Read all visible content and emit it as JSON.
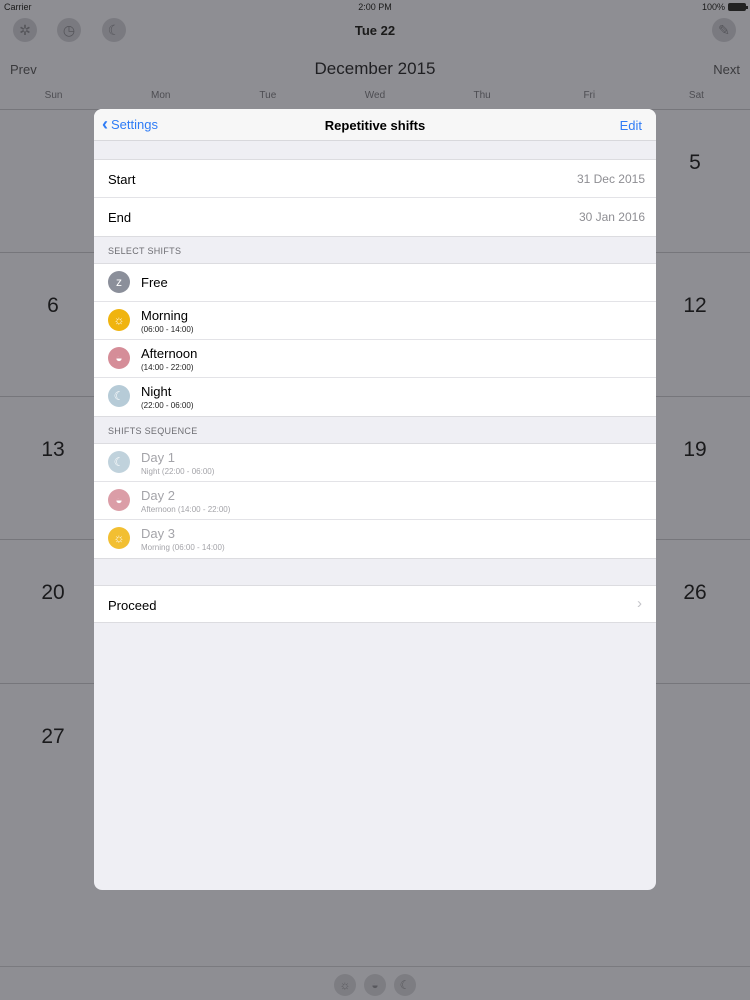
{
  "status_bar": {
    "carrier": "Carrier",
    "time": "2:00 PM",
    "battery": "100%"
  },
  "toolbar": {
    "date": "Tue 22",
    "icons": [
      "gear-icon",
      "clock-icon",
      "moon-icon",
      "brush-icon"
    ]
  },
  "calendar": {
    "prev": "Prev",
    "next": "Next",
    "month": "December 2015",
    "weekdays": [
      "Sun",
      "Mon",
      "Tue",
      "Wed",
      "Thu",
      "Fri",
      "Sat"
    ],
    "visible_days": {
      "sat_1": "5",
      "sun_2": "6",
      "sat_2": "12",
      "sun_3": "13",
      "sat_3": "19",
      "sun_4": "20",
      "sat_4": "26",
      "sun_5": "27"
    }
  },
  "modal": {
    "back_label": "Settings",
    "title": "Repetitive shifts",
    "edit_label": "Edit",
    "start": {
      "label": "Start",
      "value": "31 Dec 2015"
    },
    "end": {
      "label": "End",
      "value": "30 Jan 2016"
    },
    "select_shifts_header": "SELECT SHIFTS",
    "shifts": [
      {
        "name": "Free",
        "time": "",
        "icon": "snooze-icon",
        "color": "#8b8f9a"
      },
      {
        "name": "Morning",
        "time": "(06:00 - 14:00)",
        "icon": "sun-icon",
        "color": "#f0b40f"
      },
      {
        "name": "Afternoon",
        "time": "(14:00 - 22:00)",
        "icon": "sunset-icon",
        "color": "#d58d98"
      },
      {
        "name": "Night",
        "time": "(22:00 - 06:00)",
        "icon": "moon-icon",
        "color": "#b6cbd7"
      }
    ],
    "sequence_header": "SHIFTS SEQUENCE",
    "sequence": [
      {
        "day": "Day 1",
        "detail": "Night (22:00 - 06:00)",
        "icon": "moon-icon"
      },
      {
        "day": "Day 2",
        "detail": "Afternoon (14:00 - 22:00)",
        "icon": "sunset-icon"
      },
      {
        "day": "Day 3",
        "detail": "Morning (06:00 - 14:00)",
        "icon": "sun-icon"
      }
    ],
    "proceed_label": "Proceed"
  },
  "bottom_bar": {
    "icons": [
      "sun-icon",
      "sunset-icon",
      "moon-icon"
    ]
  },
  "colors": {
    "accent": "#2f7cf6",
    "dim_overlay": "#8e8e93"
  }
}
